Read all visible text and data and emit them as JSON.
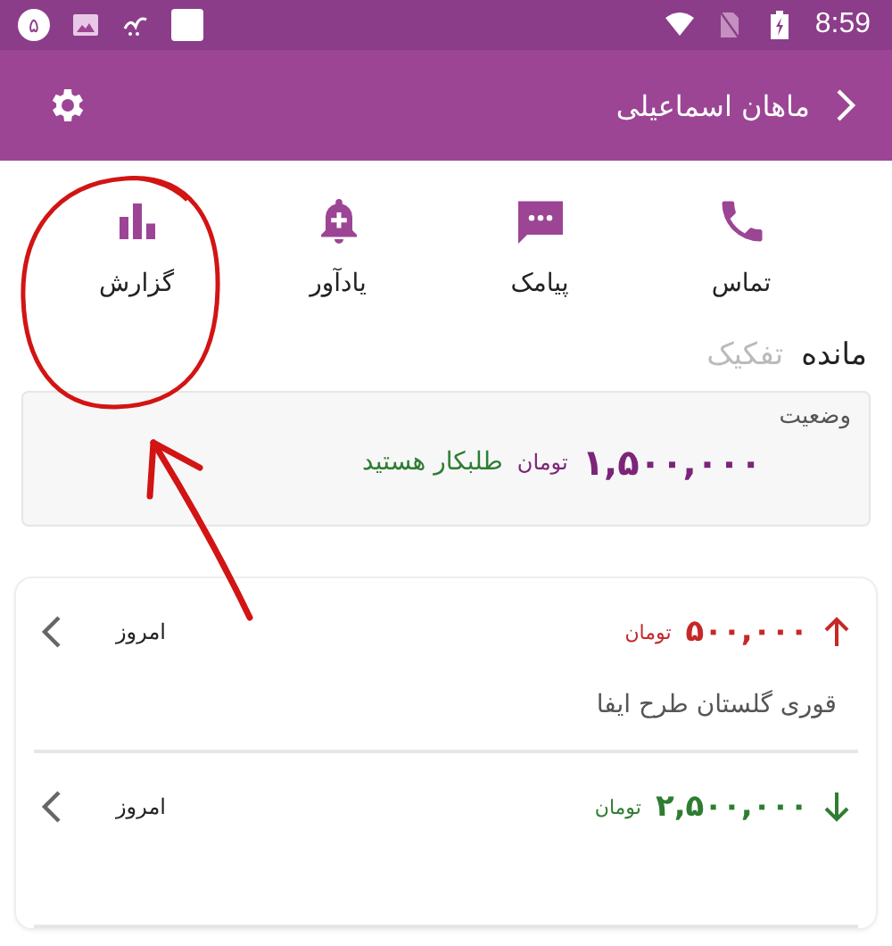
{
  "status_bar": {
    "notification_count": "۵",
    "time": "8:59"
  },
  "toolbar": {
    "title": "ماهان اسماعیلی"
  },
  "actions": [
    {
      "label": "تماس",
      "kind": "call",
      "annotated": false
    },
    {
      "label": "پیامک",
      "kind": "sms",
      "annotated": false
    },
    {
      "label": "یادآور",
      "kind": "reminder",
      "annotated": false
    },
    {
      "label": "گزارش",
      "kind": "report",
      "annotated": true
    }
  ],
  "tabs": [
    {
      "label": "مانده",
      "selected": true
    },
    {
      "label": "تفکیک",
      "selected": false
    }
  ],
  "balance": {
    "label": "وضعیت",
    "amount": "۱,۵۰۰,۰۰۰",
    "unit": "تومان",
    "status": "طلبکار هستید"
  },
  "transactions": [
    {
      "kind": "debit",
      "amount": "۵۰۰,۰۰۰",
      "unit": "تومان",
      "date": "امروز",
      "description": "قوری گلستان طرح ایفا"
    },
    {
      "kind": "credit",
      "amount": "۲,۵۰۰,۰۰۰",
      "unit": "تومان",
      "date": "امروز"
    }
  ]
}
